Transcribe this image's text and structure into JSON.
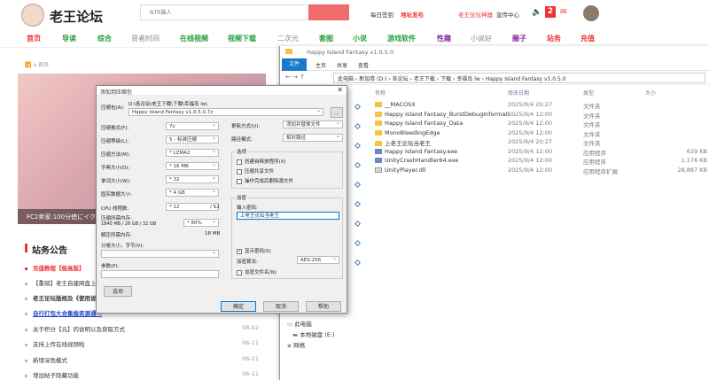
{
  "site": {
    "logo": "老王论坛",
    "search_placeholder": "NTR猫人",
    "links": [
      "每日签到",
      "地址发布",
      "老王论坛神器",
      "宣传中心"
    ],
    "notif_count": "2"
  },
  "nav": [
    "首页",
    "导读",
    "综合",
    "贤者时间",
    "在线视频",
    "视频下载",
    "二次元",
    "套图",
    "小说",
    "游戏软件",
    "性趣",
    "小说好",
    "圈子",
    "站务",
    "充值"
  ],
  "crumb": "首页",
  "hero_caption": "FC2卖家:100分徳にイク乳…",
  "news": {
    "title": "站务公告",
    "items": [
      {
        "text": "充值教程【极高版】",
        "date": ""
      },
      {
        "text": "【重磅】老王自建网盘上…",
        "date": ""
      },
      {
        "text": "老王论坛版规及《使用说明…",
        "date": ""
      },
      {
        "text": "自行打包大合集偷资源通…",
        "date": ""
      },
      {
        "text": "关于积分【元】的说明以及获取方式",
        "date": "08-02"
      },
      {
        "text": "支持上传在线视频啦",
        "date": "06-11"
      },
      {
        "text": "新增深色模式",
        "date": "06-11"
      },
      {
        "text": "增加帖子隐藏功能",
        "date": "06-11"
      }
    ]
  },
  "explorer": {
    "title": "Happy Island Fantasy v1.0.5.0",
    "ribbon": [
      "文件",
      "主页",
      "共享",
      "查看"
    ],
    "address": "此电脑 › 新加卷 (D:) › 各论坛 › 老王下载 › 下载 › 幸福岛 lw › Happy Island Fantasy v1.0.5.0",
    "columns": [
      "名称",
      "修改日期",
      "类型",
      "大小"
    ],
    "files": [
      {
        "name": "__MACOSX",
        "date": "2025/9/4 20:27",
        "type": "文件夹",
        "size": "",
        "icon": "folder"
      },
      {
        "name": "Happy Island Fantasy_BurstDebugInformati…",
        "date": "2025/9/4 12:00",
        "type": "文件夹",
        "size": "",
        "icon": "folder"
      },
      {
        "name": "Happy Island Fantasy_Data",
        "date": "2025/9/4 12:00",
        "type": "文件夹",
        "size": "",
        "icon": "folder"
      },
      {
        "name": "MonoBleedingEdge",
        "date": "2025/9/4 12:00",
        "type": "文件夹",
        "size": "",
        "icon": "folder"
      },
      {
        "name": "上老王论坛当老王",
        "date": "2025/9/4 20:27",
        "type": "文件夹",
        "size": "",
        "icon": "folder"
      },
      {
        "name": "Happy Island Fantasy.exe",
        "date": "2025/9/4 12:00",
        "type": "应用程序",
        "size": "639 KB",
        "icon": "exe"
      },
      {
        "name": "UnityCrashHandler64.exe",
        "date": "2025/9/4 12:00",
        "type": "应用程序",
        "size": "1,176 KB",
        "icon": "exe"
      },
      {
        "name": "UnityPlayer.dll",
        "date": "2025/9/4 12:00",
        "type": "应用程序扩展",
        "size": "28,887 KB",
        "icon": "dll"
      }
    ],
    "tree": [
      "此电脑",
      "本地磁盘 (E:)",
      "网络"
    ]
  },
  "dialog": {
    "title": "添加到压缩包",
    "archive_label": "压缩包(A):",
    "archive_path": "D:\\各论坛\\老王下载\\下载\\幸福岛 lw\\",
    "archive_name": "Happy Island Fantasy v1.0.5.0.7z",
    "browse": "...",
    "left_fields": [
      {
        "label": "压缩格式(F):",
        "value": "7z"
      },
      {
        "label": "压缩等级(L):",
        "value": "5 - 标准压缩"
      },
      {
        "label": "压缩方法(M):",
        "value": "* LZMA2"
      },
      {
        "label": "字典大小(D):",
        "value": "* 16 MB"
      },
      {
        "label": "单词大小(W):",
        "value": "* 32"
      },
      {
        "label": "固实数据大小:",
        "value": "* 4 GB"
      }
    ],
    "cpu_label": "CPU 线程数:",
    "cpu_value": "* 12",
    "cpu_max": "/ 12",
    "mem_label": "压缩所需内存:",
    "mem_value": "1840 MB / 26 GB / 32 GB",
    "mem_pct": "* 80%",
    "decomp_label": "解压所需内存:",
    "decomp_value": "18 MB",
    "split_label": "分卷大小，字节(V):",
    "params_label": "参数(P):",
    "options_button": "选项",
    "update_label": "更新方式(U):",
    "update_value": "添加并替换文件",
    "pathmode_label": "路径模式:",
    "pathmode_value": "相对路径",
    "options_title": "选项",
    "options": [
      {
        "label": "创建自释放程序(X)",
        "checked": false
      },
      {
        "label": "压缩共享文件",
        "checked": false
      },
      {
        "label": "操作完成后删除源文件",
        "checked": false
      }
    ],
    "encrypt_title": "加密",
    "pwd_label": "输入密码:",
    "pwd_value": "上老王论坛当老王",
    "show_pwd": "显示密码(S)",
    "enc_method_label": "加密算法:",
    "enc_method_value": "AES-256",
    "enc_names": "加密文件名(N)",
    "ok": "确定",
    "cancel": "取消",
    "help": "帮助"
  },
  "colors": {
    "accent": "#e33333",
    "nav_red": "#e33333",
    "explorer_blue": "#1979ca"
  }
}
